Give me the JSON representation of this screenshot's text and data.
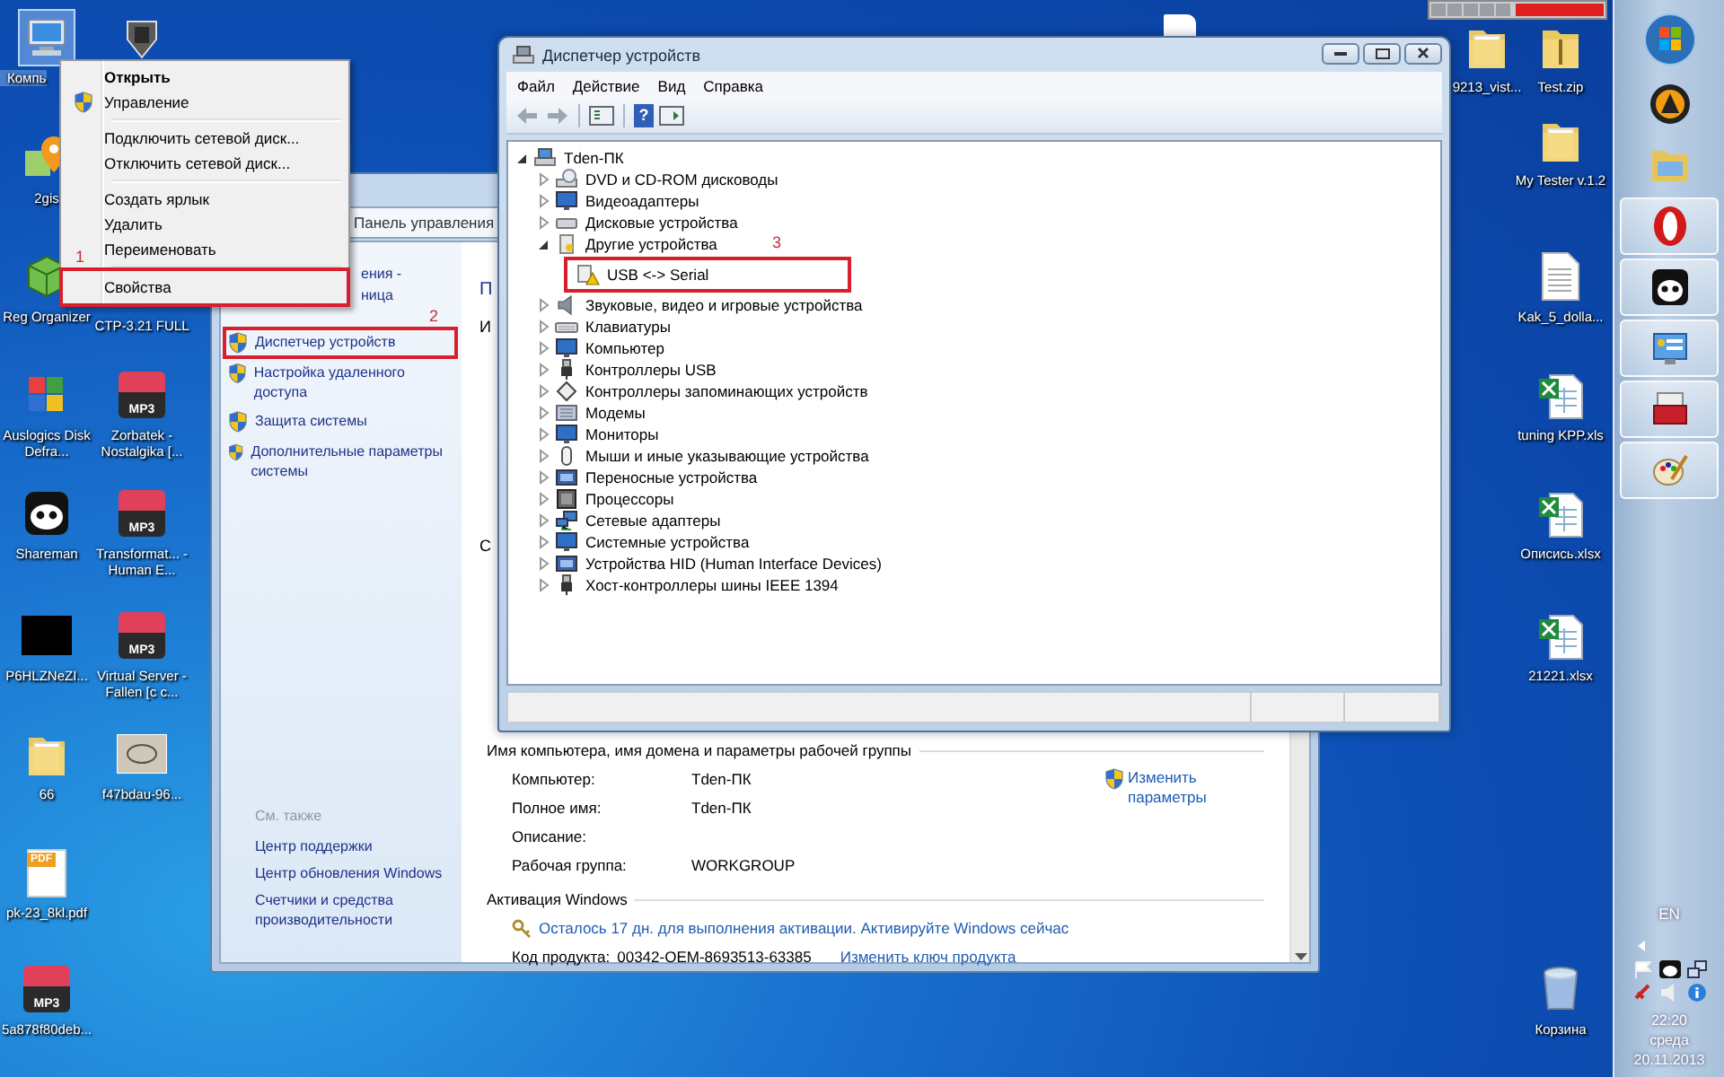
{
  "desktop": {
    "left_icons": [
      {
        "label": "Компь",
        "kind": "computer",
        "selected": true
      },
      {
        "label": "2gis",
        "kind": "map-app",
        "selected": false
      },
      {
        "label": "Reg Organizer",
        "kind": "cube-app",
        "selected": false
      },
      {
        "label": "Auslogics Disk Defra...",
        "kind": "puzzle-app",
        "selected": false
      },
      {
        "label": "Shareman",
        "kind": "panda",
        "selected": false
      },
      {
        "label": "P6HLZNeZI...",
        "kind": "black-image",
        "selected": false
      },
      {
        "label": "66",
        "kind": "folder",
        "selected": false
      },
      {
        "label": "pk-23_8kl.pdf",
        "kind": "pdf",
        "badge": "PDF",
        "selected": false
      },
      {
        "label": "5a878f80deb...",
        "kind": "mp3",
        "badge": "MP3",
        "selected": false
      }
    ],
    "second_icons": [
      {
        "kind": "game",
        "selected": false
      },
      {
        "label": "CTP-3.21 FULL"
      },
      {
        "label": "Zorbatek - Nostalgika [...",
        "kind": "mp3",
        "badge": "MP3",
        "selected": false
      },
      {
        "label": "Transformat... - Human E...",
        "kind": "mp3",
        "badge": "MP3",
        "selected": false
      },
      {
        "label": "Virtual Server - Fallen [c c...",
        "kind": "mp3",
        "badge": "MP3",
        "selected": false
      },
      {
        "label": "f47bdau-96...",
        "kind": "image",
        "selected": false
      }
    ],
    "right_icons": [
      {
        "label": "9213_vist...",
        "kind": "folder",
        "selected": false
      },
      {
        "label": "Test.zip",
        "kind": "zip",
        "selected": false
      },
      {
        "label": "My Tester v.1.2",
        "kind": "folder",
        "selected": false
      },
      {
        "label": "Kak_5_dolla...",
        "kind": "text-file",
        "selected": false
      },
      {
        "label": "tuning KPP.xls",
        "kind": "excel",
        "selected": false
      },
      {
        "label": "Описись.xlsx",
        "kind": "excel",
        "selected": false
      },
      {
        "label": "21221.xlsx",
        "kind": "excel",
        "selected": false
      },
      {
        "label": "Корзина",
        "kind": "trash",
        "selected": false
      }
    ]
  },
  "context_menu": [
    {
      "kind": "default",
      "label": "Открыть"
    },
    {
      "kind": "shield",
      "label": "Управление"
    },
    {
      "kind": "separator"
    },
    {
      "kind": "item",
      "label": "Подключить сетевой диск..."
    },
    {
      "kind": "item",
      "label": "Отключить сетевой диск..."
    },
    {
      "kind": "separator"
    },
    {
      "kind": "item",
      "label": "Создать ярлык"
    },
    {
      "kind": "item",
      "label": "Удалить"
    },
    {
      "kind": "item",
      "label": "Переименовать"
    },
    {
      "kind": "separator"
    },
    {
      "kind": "item",
      "label": "Свойства",
      "highlight": "1"
    }
  ],
  "system_window": {
    "breadcrumb": "Панель управления",
    "home_link_fragments": [
      "ения -",
      "ница"
    ],
    "tasks": [
      {
        "label": "Диспетчер устройств",
        "highlight": "2"
      },
      {
        "label": "Настройка удаленного доступа"
      },
      {
        "label": "Защита системы"
      },
      {
        "label": "Дополнительные параметры системы"
      }
    ],
    "see_also_title": "См. также",
    "see_also": [
      "Центр поддержки",
      "Центр обновления Windows",
      "Счетчики и средства производительности"
    ],
    "content_fragments": [
      "П",
      "И",
      "С"
    ],
    "computer_section": {
      "title": "Имя компьютера, имя домена и параметры рабочей группы",
      "rows": [
        {
          "label": "Компьютер:",
          "value": "Tden-ПК"
        },
        {
          "label": "Полное имя:",
          "value": "Tden-ПК"
        },
        {
          "label": "Описание:"
        },
        {
          "label": "Рабочая группа:",
          "value": "WORKGROUP"
        }
      ],
      "change_link": "Изменить параметры"
    },
    "activation_section": {
      "title": "Активация Windows",
      "notice": "Осталось 17 дн. для выполнения активации. Активируйте Windows сейчас",
      "product_key_label": "Код продукта:",
      "product_key": "00342-OEM-8693513-63385",
      "change_key_link": "Изменить ключ продукта"
    }
  },
  "device_manager": {
    "title": "Диспетчер устройств",
    "menu": [
      "Файл",
      "Действие",
      "Вид",
      "Справка"
    ],
    "toolbar": [
      {
        "kind": "back",
        "disabled": true
      },
      {
        "kind": "forward",
        "disabled": true
      },
      {
        "kind": "properties",
        "disabled": false
      },
      {
        "kind": "help",
        "glyph": "?",
        "disabled": false
      },
      {
        "kind": "update",
        "disabled": false
      }
    ],
    "tree": {
      "label": "Tden-ПК",
      "kind": "computer",
      "expanded": true,
      "children": [
        {
          "label": "DVD и CD-ROM дисководы",
          "kind": "dvd",
          "expanded": false
        },
        {
          "label": "Видеоадаптеры",
          "kind": "monitor",
          "expanded": false
        },
        {
          "label": "Дисковые устройства",
          "kind": "disk",
          "expanded": false
        },
        {
          "label": "Другие устройства",
          "kind": "other",
          "expanded": true,
          "children": [
            {
              "label": "USB <-> Serial",
              "kind": "warning",
              "highlight": "3"
            }
          ]
        },
        {
          "label": "Звуковые, видео и игровые устройства",
          "kind": "speaker",
          "expanded": false
        },
        {
          "label": "Клавиатуры",
          "kind": "keyboard",
          "expanded": false
        },
        {
          "label": "Компьютер",
          "kind": "monitor",
          "expanded": false
        },
        {
          "label": "Контроллеры USB",
          "kind": "usb",
          "expanded": false
        },
        {
          "label": "Контроллеры запоминающих устройств",
          "kind": "storage",
          "expanded": false
        },
        {
          "label": "Модемы",
          "kind": "modem",
          "expanded": false
        },
        {
          "label": "Мониторы",
          "kind": "monitor",
          "expanded": false
        },
        {
          "label": "Мыши и иные указывающие устройства",
          "kind": "mouse",
          "expanded": false
        },
        {
          "label": "Переносные устройства",
          "kind": "device",
          "expanded": false
        },
        {
          "label": "Процессоры",
          "kind": "chip",
          "expanded": false
        },
        {
          "label": "Сетевые адаптеры",
          "kind": "network",
          "expanded": false
        },
        {
          "label": "Системные устройства",
          "kind": "monitor",
          "expanded": false
        },
        {
          "label": "Устройства HID (Human Interface Devices)",
          "kind": "device",
          "expanded": false
        },
        {
          "label": "Хост-контроллеры шины IEEE 1394",
          "kind": "usb",
          "expanded": false
        }
      ]
    }
  },
  "taskbar": {
    "items": [
      {
        "kind": "start",
        "running": false
      },
      {
        "kind": "aimp",
        "running": false
      },
      {
        "kind": "folder",
        "running": false
      },
      {
        "kind": "opera",
        "running": true
      },
      {
        "kind": "panda",
        "running": true
      },
      {
        "kind": "control-panel",
        "running": true
      },
      {
        "kind": "toolbox",
        "running": true
      },
      {
        "kind": "palette",
        "running": true
      }
    ],
    "language": "EN",
    "clock": {
      "time": "22:20",
      "day": "среда",
      "date": "20.11.2013"
    }
  }
}
